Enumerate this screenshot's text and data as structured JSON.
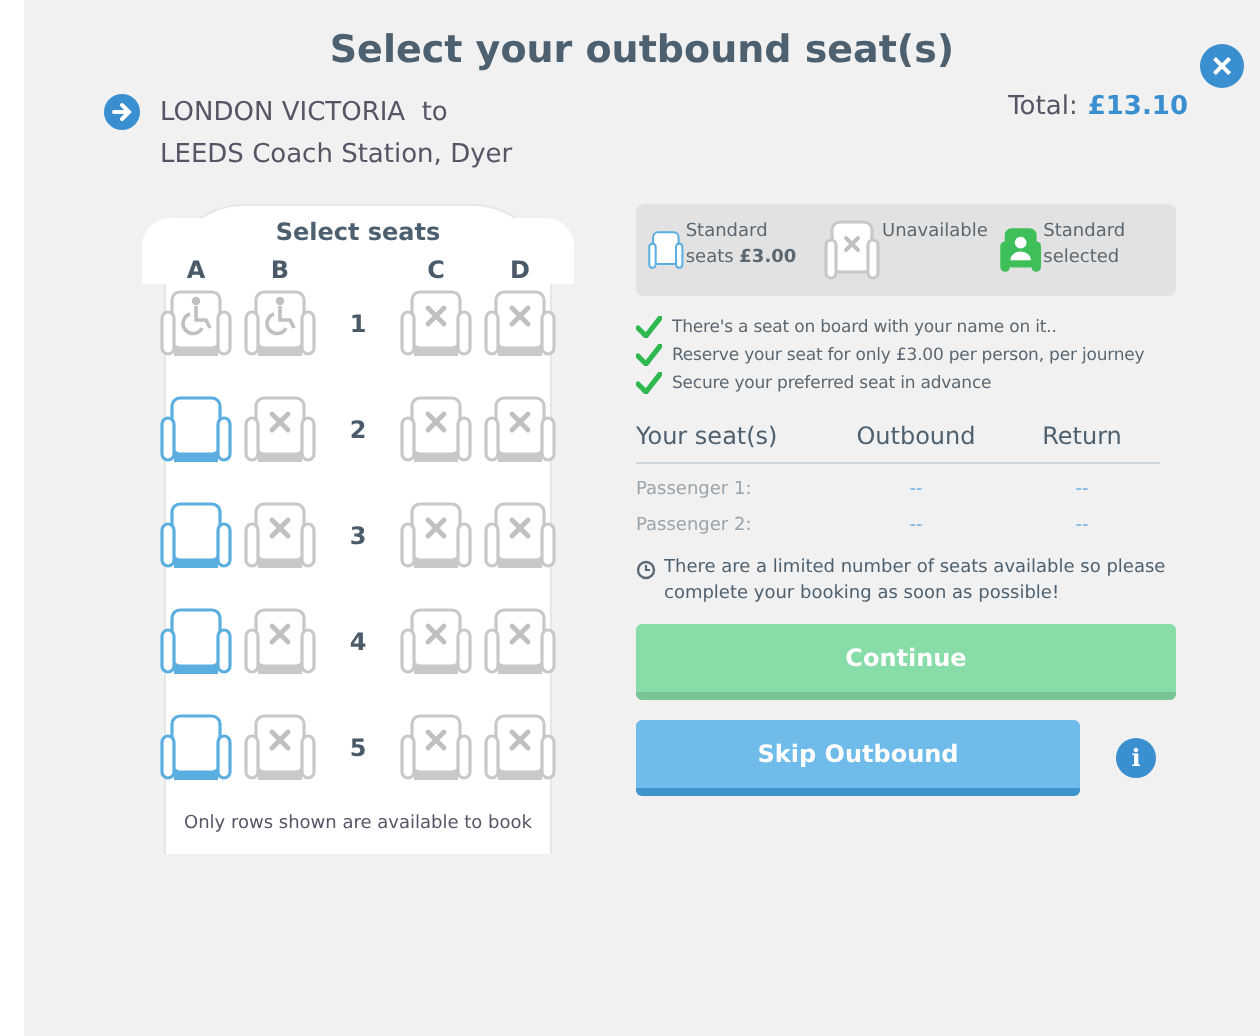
{
  "title": "Select your outbound seat(s)",
  "close_label": "×",
  "route": {
    "from": "LONDON VICTORIA  to",
    "to": "LEEDS Coach Station, Dyer"
  },
  "total": {
    "label": "Total:",
    "amount": "£13.10"
  },
  "seat_map": {
    "heading": "Select seats",
    "columns": [
      "A",
      "B",
      "C",
      "D"
    ],
    "rows": [
      {
        "number": "1",
        "seats": [
          {
            "kind": "wheelchair"
          },
          {
            "kind": "wheelchair"
          },
          {
            "kind": "unavailable"
          },
          {
            "kind": "unavailable"
          }
        ]
      },
      {
        "number": "2",
        "seats": [
          {
            "kind": "available"
          },
          {
            "kind": "unavailable"
          },
          {
            "kind": "unavailable"
          },
          {
            "kind": "unavailable"
          }
        ]
      },
      {
        "number": "3",
        "seats": [
          {
            "kind": "available"
          },
          {
            "kind": "unavailable"
          },
          {
            "kind": "unavailable"
          },
          {
            "kind": "unavailable"
          }
        ]
      },
      {
        "number": "4",
        "seats": [
          {
            "kind": "available"
          },
          {
            "kind": "unavailable"
          },
          {
            "kind": "unavailable"
          },
          {
            "kind": "unavailable"
          }
        ]
      },
      {
        "number": "5",
        "seats": [
          {
            "kind": "available"
          },
          {
            "kind": "unavailable"
          },
          {
            "kind": "unavailable"
          },
          {
            "kind": "unavailable"
          }
        ]
      }
    ],
    "note": "Only rows shown are available to book"
  },
  "legend": [
    {
      "kind": "available",
      "label": "Standard seats **£3.00**"
    },
    {
      "kind": "unavailable",
      "label": "Unavailable"
    },
    {
      "kind": "selected",
      "label": "Standard selected"
    }
  ],
  "benefits": [
    "There's a seat on board with your name on it..",
    "Reserve your seat for only £3.00 per person, per journey",
    "Secure your preferred seat in advance"
  ],
  "seat_table": {
    "columns": [
      "Your seat(s)",
      "Outbound",
      "Return"
    ],
    "rows": [
      {
        "passenger": "Passenger 1:",
        "outbound": "--",
        "return": "--"
      },
      {
        "passenger": "Passenger 2:",
        "outbound": "--",
        "return": "--"
      }
    ]
  },
  "warning": "There are a limited number of seats available so please complete your booking as soon as possible!",
  "continue_button": {
    "label": "Continue",
    "disabled": true
  },
  "skip_button": {
    "label": "Skip Outbound"
  },
  "info_label": "i"
}
